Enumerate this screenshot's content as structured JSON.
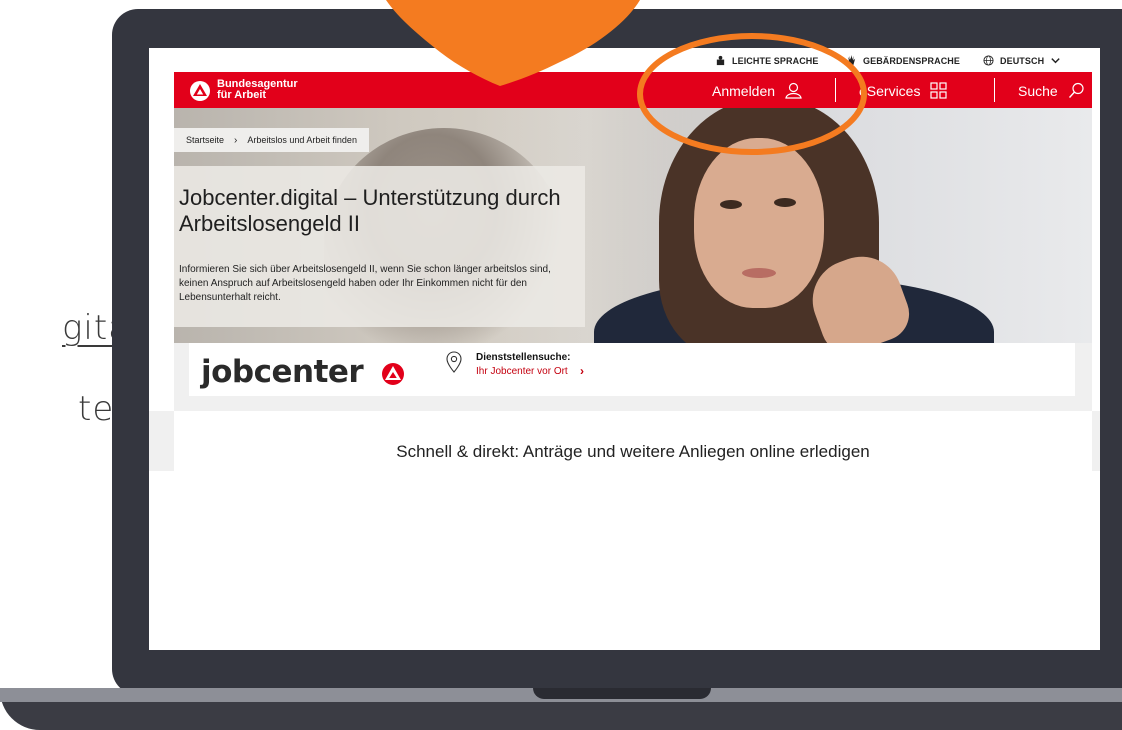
{
  "slide": {
    "line1": "gital",
    "line2": "te"
  },
  "topbar": {
    "easy_language": "LEICHTE SPRACHE",
    "sign_language": "GEBÄRDENSPRACHE",
    "language": "DEUTSCH"
  },
  "header": {
    "brand_line1": "Bundesagentur",
    "brand_line2": "für Arbeit",
    "login": "Anmelden",
    "eservices": "eServices",
    "search": "Suche"
  },
  "breadcrumb": {
    "home": "Startseite",
    "current": "Arbeitslos und Arbeit finden"
  },
  "hero": {
    "title": "Jobcenter.digital – Unterstützung durch Arbeitslosengeld II",
    "description": "Informieren Sie sich über Arbeitslosengeld II, wenn Sie schon länger arbeitslos sind, keinen Anspruch auf Arbeitslosengeld haben oder Ihr Einkommen nicht für den Lebensunterhalt reicht."
  },
  "jobcenter": {
    "logo": "jobcenter",
    "office_search_label": "Dienststellensuche:",
    "office_search_link": "Ihr Jobcenter vor Ort"
  },
  "section": {
    "title": "Schnell & direkt: Anträge und weitere Anliegen online erledigen"
  },
  "colors": {
    "brand_red": "#e2001a",
    "annotation_orange": "#f47b20",
    "laptop": "#34363f"
  },
  "icons": [
    "user-icon",
    "grid-icon",
    "search-icon",
    "globe-icon",
    "hand-icon",
    "easy-language-icon",
    "location-pin-icon",
    "chevron-down-icon"
  ]
}
